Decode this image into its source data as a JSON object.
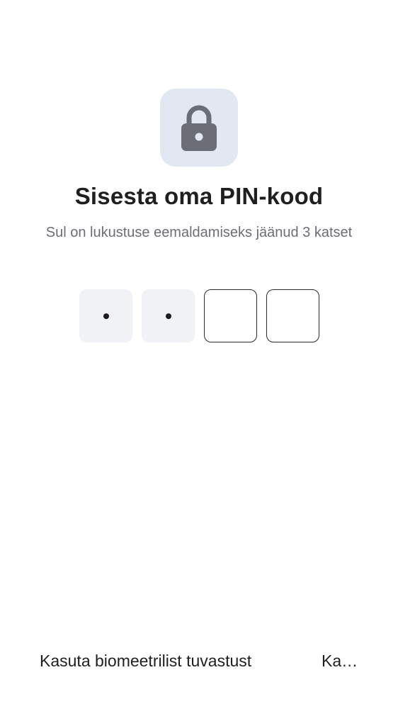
{
  "lock": {
    "icon": "lock-icon",
    "tile_color": "#e3e7f1",
    "icon_color": "#6b6e76"
  },
  "title": "Sisesta oma PIN-kood",
  "subtitle": "Sul on lukustuse eemaldamiseks jäänud 3 katset",
  "pin": {
    "length": 4,
    "entered": 2
  },
  "actions": {
    "biometric_label": "Kasuta biomeetrilist tuvastust",
    "other_label": "Ka…"
  }
}
